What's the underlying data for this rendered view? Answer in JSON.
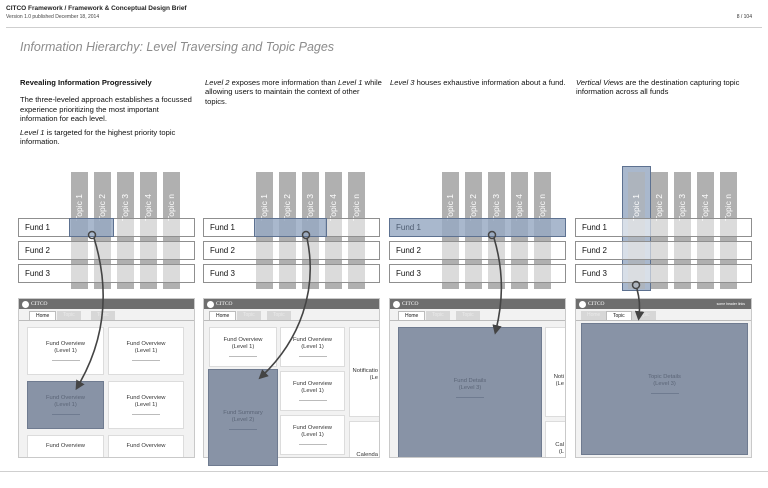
{
  "header": {
    "title": "CITCO Framework / Framework & Conceptual Design Brief",
    "subtitle": "Version 1.0 published December 18, 2014",
    "page": "8 / 104"
  },
  "slide_title": "Information Hierarchy: Level Traversing and Topic Pages",
  "col1": {
    "heading": "Revealing Information Progressively",
    "p1": "The three-leveled approach establishes a focussed experience prioritizing the most important information for each level.",
    "p2_em": "Level 1",
    "p2_rest": " is targeted for the highest priority topic information."
  },
  "col2": {
    "em1": "Level 2",
    "t1": " exposes more information than ",
    "em2": "Level 1",
    "t2": " while allowing users to maintain the context of other topics."
  },
  "col3": {
    "em": "Level 3",
    "t": " houses exhaustive information about a fund."
  },
  "col4": {
    "em": "Vertical Views",
    "t": " are the destination capturing topic information across all funds"
  },
  "topics": [
    "Topic 1",
    "Topic 2",
    "Topic 3",
    "Topic 4",
    "Topic n"
  ],
  "funds": [
    "Fund 1",
    "Fund 2",
    "Fund 3"
  ],
  "mock": {
    "logo": "CITCO",
    "header_link": "some header links",
    "tabs": [
      "Home",
      "Topic",
      "Topic"
    ],
    "card_fund_overview": "Fund Overview",
    "card_level1": "(Level 1)",
    "card_fund_summary": "Fund Summary",
    "card_level2": "(Level 2)",
    "card_fund_details": "Fund Details",
    "card_level3": "(Level 3)",
    "card_topic_details": "Topic Details",
    "card_notifications": "Notificatio",
    "card_notifications_short": "Noti",
    "card_level_short": "(Le",
    "card_calendar": "Calenda",
    "card_calendar_short": "Cal",
    "card_level_tiny": "(L"
  },
  "colors": {
    "topic_gray": "#b0b0b0",
    "highlight_blue": "#7088ab",
    "arrow": "#444444"
  }
}
